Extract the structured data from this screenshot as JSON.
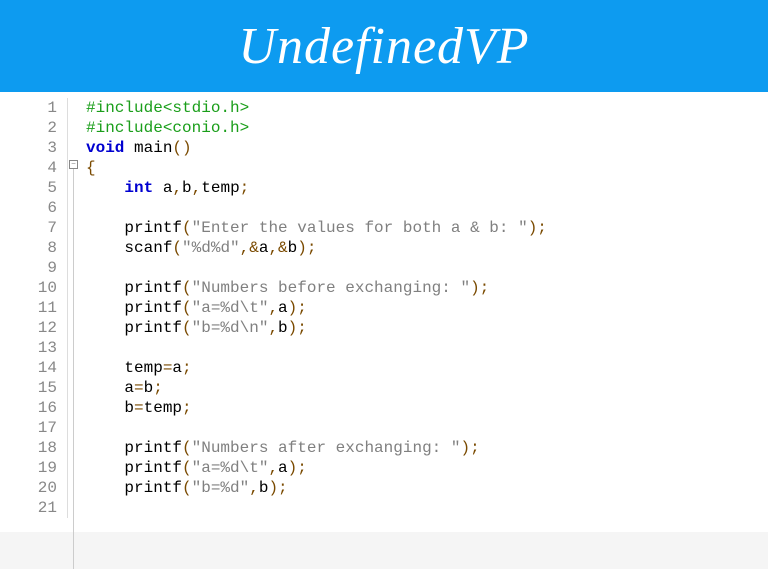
{
  "header": {
    "title": "UndefinedVP"
  },
  "code": {
    "lines": [
      {
        "n": 1,
        "tokens": [
          {
            "c": "tk-pre",
            "t": "#include<stdio.h>"
          }
        ]
      },
      {
        "n": 2,
        "tokens": [
          {
            "c": "tk-pre",
            "t": "#include<conio.h>"
          }
        ]
      },
      {
        "n": 3,
        "tokens": [
          {
            "c": "tk-kw",
            "t": "void"
          },
          {
            "c": "",
            "t": " "
          },
          {
            "c": "tk-fn",
            "t": "main"
          },
          {
            "c": "tk-pun",
            "t": "()"
          }
        ]
      },
      {
        "n": 4,
        "tokens": [
          {
            "c": "tk-brace",
            "t": "{"
          }
        ]
      },
      {
        "n": 5,
        "tokens": [
          {
            "c": "",
            "t": "    "
          },
          {
            "c": "tk-type",
            "t": "int"
          },
          {
            "c": "",
            "t": " "
          },
          {
            "c": "tk-id",
            "t": "a"
          },
          {
            "c": "tk-pun",
            "t": ","
          },
          {
            "c": "tk-id",
            "t": "b"
          },
          {
            "c": "tk-pun",
            "t": ","
          },
          {
            "c": "tk-id",
            "t": "temp"
          },
          {
            "c": "tk-pun",
            "t": ";"
          }
        ]
      },
      {
        "n": 6,
        "tokens": [
          {
            "c": "",
            "t": ""
          }
        ]
      },
      {
        "n": 7,
        "tokens": [
          {
            "c": "",
            "t": "    "
          },
          {
            "c": "tk-fn",
            "t": "printf"
          },
          {
            "c": "tk-pun",
            "t": "("
          },
          {
            "c": "tk-str",
            "t": "\"Enter the values for both a & b: \""
          },
          {
            "c": "tk-pun",
            "t": ");"
          }
        ]
      },
      {
        "n": 8,
        "tokens": [
          {
            "c": "",
            "t": "    "
          },
          {
            "c": "tk-fn",
            "t": "scanf"
          },
          {
            "c": "tk-pun",
            "t": "("
          },
          {
            "c": "tk-str",
            "t": "\"%d%d\""
          },
          {
            "c": "tk-pun",
            "t": ",&"
          },
          {
            "c": "tk-id",
            "t": "a"
          },
          {
            "c": "tk-pun",
            "t": ",&"
          },
          {
            "c": "tk-id",
            "t": "b"
          },
          {
            "c": "tk-pun",
            "t": ");"
          }
        ]
      },
      {
        "n": 9,
        "tokens": [
          {
            "c": "",
            "t": ""
          }
        ]
      },
      {
        "n": 10,
        "tokens": [
          {
            "c": "",
            "t": "    "
          },
          {
            "c": "tk-fn",
            "t": "printf"
          },
          {
            "c": "tk-pun",
            "t": "("
          },
          {
            "c": "tk-str",
            "t": "\"Numbers before exchanging: \""
          },
          {
            "c": "tk-pun",
            "t": ");"
          }
        ]
      },
      {
        "n": 11,
        "tokens": [
          {
            "c": "",
            "t": "    "
          },
          {
            "c": "tk-fn",
            "t": "printf"
          },
          {
            "c": "tk-pun",
            "t": "("
          },
          {
            "c": "tk-str",
            "t": "\"a=%d\\t\""
          },
          {
            "c": "tk-pun",
            "t": ","
          },
          {
            "c": "tk-id",
            "t": "a"
          },
          {
            "c": "tk-pun",
            "t": ");"
          }
        ]
      },
      {
        "n": 12,
        "tokens": [
          {
            "c": "",
            "t": "    "
          },
          {
            "c": "tk-fn",
            "t": "printf"
          },
          {
            "c": "tk-pun",
            "t": "("
          },
          {
            "c": "tk-str",
            "t": "\"b=%d\\n\""
          },
          {
            "c": "tk-pun",
            "t": ","
          },
          {
            "c": "tk-id",
            "t": "b"
          },
          {
            "c": "tk-pun",
            "t": ");"
          }
        ]
      },
      {
        "n": 13,
        "tokens": [
          {
            "c": "",
            "t": ""
          }
        ]
      },
      {
        "n": 14,
        "tokens": [
          {
            "c": "",
            "t": "    "
          },
          {
            "c": "tk-id",
            "t": "temp"
          },
          {
            "c": "tk-pun",
            "t": "="
          },
          {
            "c": "tk-id",
            "t": "a"
          },
          {
            "c": "tk-pun",
            "t": ";"
          }
        ]
      },
      {
        "n": 15,
        "tokens": [
          {
            "c": "",
            "t": "    "
          },
          {
            "c": "tk-id",
            "t": "a"
          },
          {
            "c": "tk-pun",
            "t": "="
          },
          {
            "c": "tk-id",
            "t": "b"
          },
          {
            "c": "tk-pun",
            "t": ";"
          }
        ]
      },
      {
        "n": 16,
        "tokens": [
          {
            "c": "",
            "t": "    "
          },
          {
            "c": "tk-id",
            "t": "b"
          },
          {
            "c": "tk-pun",
            "t": "="
          },
          {
            "c": "tk-id",
            "t": "temp"
          },
          {
            "c": "tk-pun",
            "t": ";"
          }
        ]
      },
      {
        "n": 17,
        "tokens": [
          {
            "c": "",
            "t": ""
          }
        ]
      },
      {
        "n": 18,
        "tokens": [
          {
            "c": "",
            "t": "    "
          },
          {
            "c": "tk-fn",
            "t": "printf"
          },
          {
            "c": "tk-pun",
            "t": "("
          },
          {
            "c": "tk-str",
            "t": "\"Numbers after exchanging: \""
          },
          {
            "c": "tk-pun",
            "t": ");"
          }
        ]
      },
      {
        "n": 19,
        "tokens": [
          {
            "c": "",
            "t": "    "
          },
          {
            "c": "tk-fn",
            "t": "printf"
          },
          {
            "c": "tk-pun",
            "t": "("
          },
          {
            "c": "tk-str",
            "t": "\"a=%d\\t\""
          },
          {
            "c": "tk-pun",
            "t": ","
          },
          {
            "c": "tk-id",
            "t": "a"
          },
          {
            "c": "tk-pun",
            "t": ");"
          }
        ]
      },
      {
        "n": 20,
        "tokens": [
          {
            "c": "",
            "t": "    "
          },
          {
            "c": "tk-fn",
            "t": "printf"
          },
          {
            "c": "tk-pun",
            "t": "("
          },
          {
            "c": "tk-str",
            "t": "\"b=%d\""
          },
          {
            "c": "tk-pun",
            "t": ","
          },
          {
            "c": "tk-id",
            "t": "b"
          },
          {
            "c": "tk-pun",
            "t": ");"
          }
        ]
      },
      {
        "n": 21,
        "tokens": [
          {
            "c": "",
            "t": ""
          }
        ]
      }
    ]
  },
  "fold": {
    "symbol": "−"
  }
}
